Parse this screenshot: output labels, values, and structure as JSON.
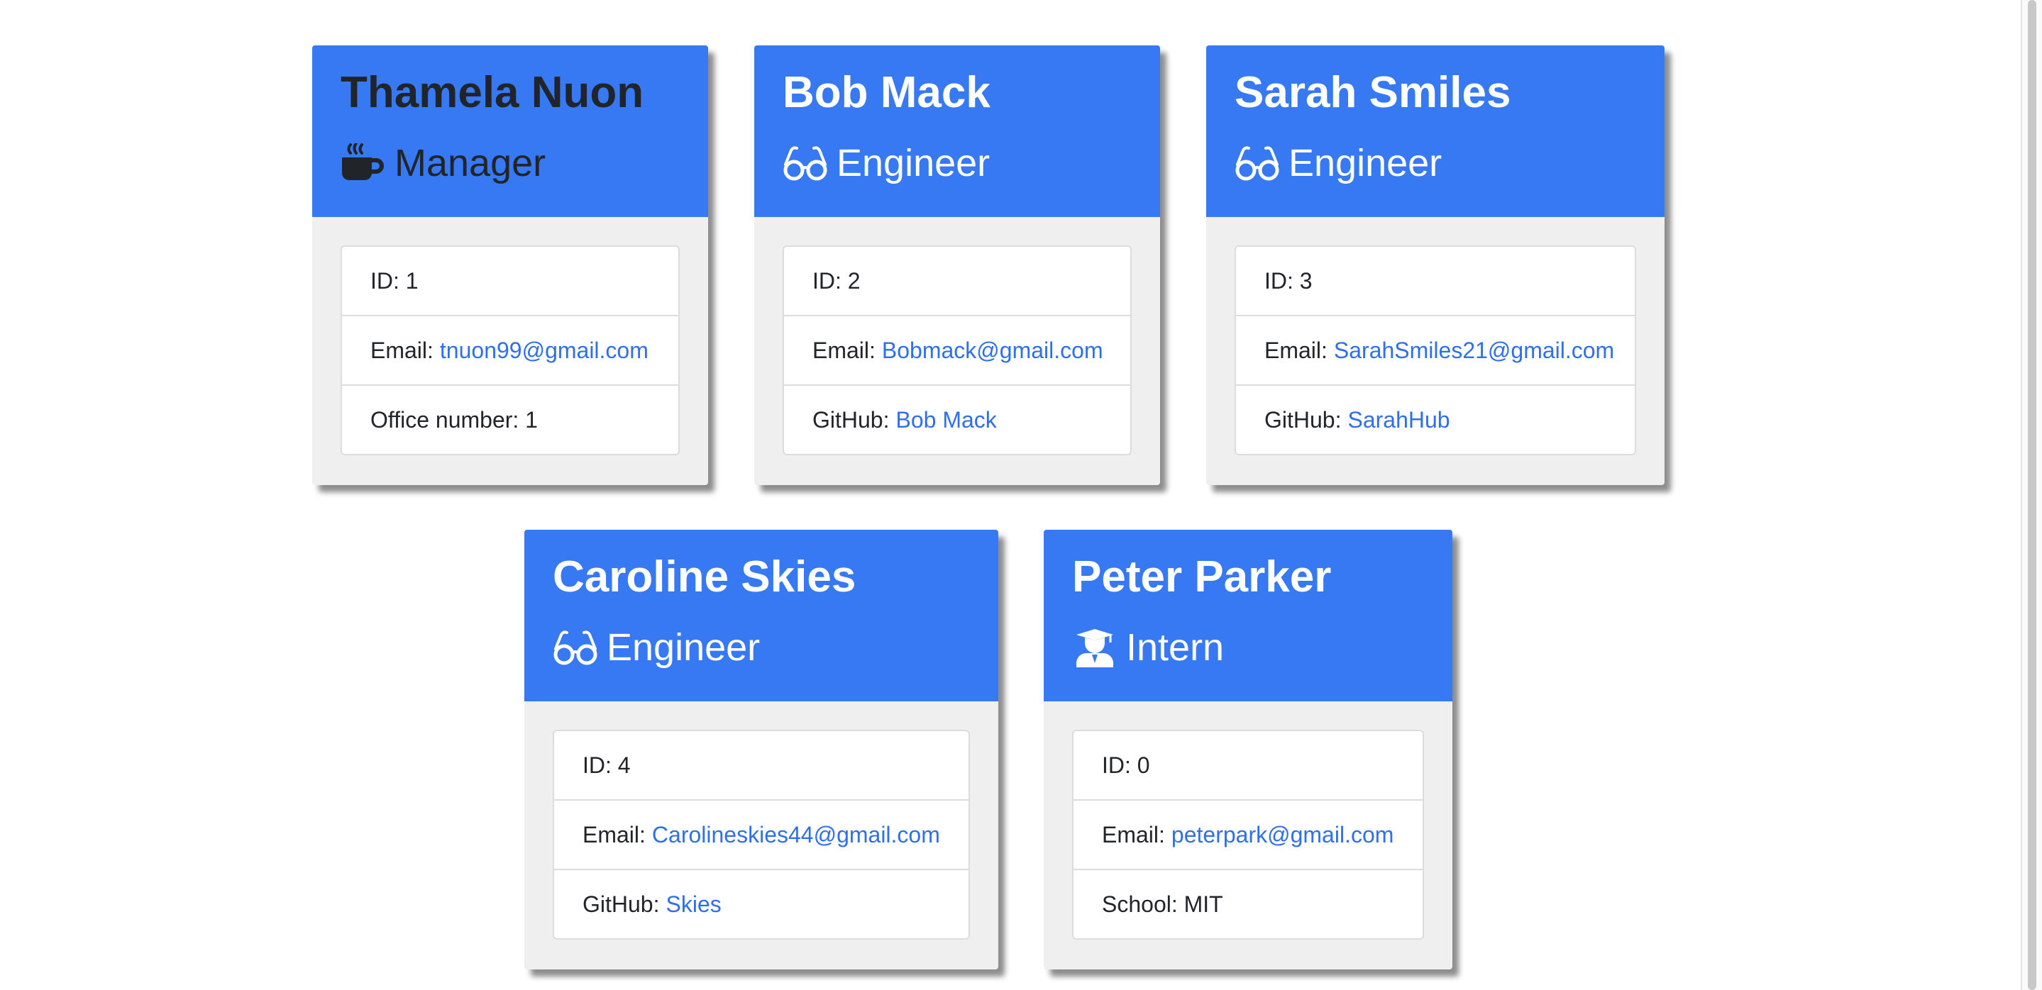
{
  "employees": [
    {
      "name": "Thamela Nuon",
      "role": "Manager",
      "icon": "coffee-icon",
      "id_label": "ID: 1",
      "email_label": "Email:",
      "email": "tnuon99@gmail.com",
      "extra_label": "Office number: 1",
      "extra_link": ""
    },
    {
      "name": "Bob Mack",
      "role": "Engineer",
      "icon": "glasses-icon",
      "id_label": "ID: 2",
      "email_label": "Email:",
      "email": "Bobmack@gmail.com",
      "extra_label": "GitHub:",
      "extra_link": "Bob Mack"
    },
    {
      "name": "Sarah Smiles",
      "role": "Engineer",
      "icon": "glasses-icon",
      "id_label": "ID: 3",
      "email_label": "Email:",
      "email": "SarahSmiles21@gmail.com",
      "extra_label": "GitHub:",
      "extra_link": "SarahHub"
    },
    {
      "name": "Caroline Skies",
      "role": "Engineer",
      "icon": "glasses-icon",
      "id_label": "ID: 4",
      "email_label": "Email:",
      "email": "Carolineskies44@gmail.com",
      "extra_label": "GitHub:",
      "extra_link": "Skies"
    },
    {
      "name": "Peter Parker",
      "role": "Intern",
      "icon": "graduate-icon",
      "id_label": "ID: 0",
      "email_label": "Email:",
      "email": "peterpark@gmail.com",
      "extra_label": "School: MIT",
      "extra_link": ""
    }
  ],
  "colors": {
    "header": "#3779f3",
    "link": "#2f6fe9",
    "body": "#efefef"
  }
}
